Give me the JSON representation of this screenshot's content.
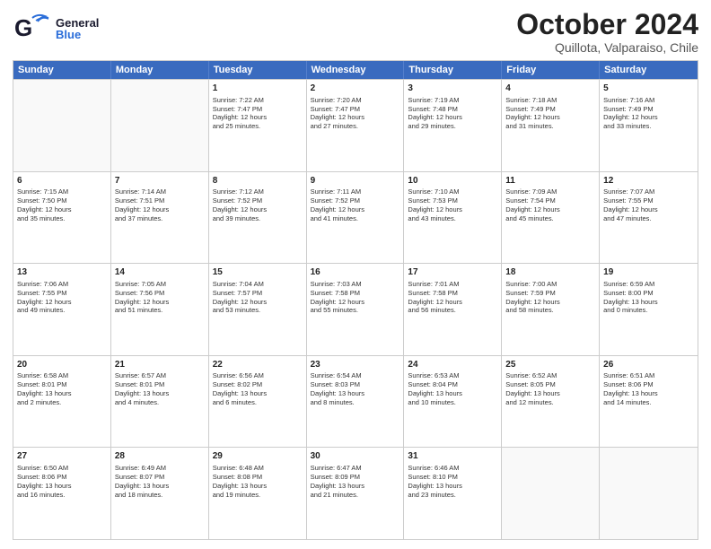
{
  "header": {
    "logo_general": "General",
    "logo_blue": "Blue",
    "month_title": "October 2024",
    "subtitle": "Quillota, Valparaiso, Chile"
  },
  "days_of_week": [
    "Sunday",
    "Monday",
    "Tuesday",
    "Wednesday",
    "Thursday",
    "Friday",
    "Saturday"
  ],
  "weeks": [
    [
      {
        "day": "",
        "empty": true
      },
      {
        "day": "",
        "empty": true
      },
      {
        "day": "1",
        "lines": [
          "Sunrise: 7:22 AM",
          "Sunset: 7:47 PM",
          "Daylight: 12 hours",
          "and 25 minutes."
        ]
      },
      {
        "day": "2",
        "lines": [
          "Sunrise: 7:20 AM",
          "Sunset: 7:47 PM",
          "Daylight: 12 hours",
          "and 27 minutes."
        ]
      },
      {
        "day": "3",
        "lines": [
          "Sunrise: 7:19 AM",
          "Sunset: 7:48 PM",
          "Daylight: 12 hours",
          "and 29 minutes."
        ]
      },
      {
        "day": "4",
        "lines": [
          "Sunrise: 7:18 AM",
          "Sunset: 7:49 PM",
          "Daylight: 12 hours",
          "and 31 minutes."
        ]
      },
      {
        "day": "5",
        "lines": [
          "Sunrise: 7:16 AM",
          "Sunset: 7:49 PM",
          "Daylight: 12 hours",
          "and 33 minutes."
        ]
      }
    ],
    [
      {
        "day": "6",
        "lines": [
          "Sunrise: 7:15 AM",
          "Sunset: 7:50 PM",
          "Daylight: 12 hours",
          "and 35 minutes."
        ]
      },
      {
        "day": "7",
        "lines": [
          "Sunrise: 7:14 AM",
          "Sunset: 7:51 PM",
          "Daylight: 12 hours",
          "and 37 minutes."
        ]
      },
      {
        "day": "8",
        "lines": [
          "Sunrise: 7:12 AM",
          "Sunset: 7:52 PM",
          "Daylight: 12 hours",
          "and 39 minutes."
        ]
      },
      {
        "day": "9",
        "lines": [
          "Sunrise: 7:11 AM",
          "Sunset: 7:52 PM",
          "Daylight: 12 hours",
          "and 41 minutes."
        ]
      },
      {
        "day": "10",
        "lines": [
          "Sunrise: 7:10 AM",
          "Sunset: 7:53 PM",
          "Daylight: 12 hours",
          "and 43 minutes."
        ]
      },
      {
        "day": "11",
        "lines": [
          "Sunrise: 7:09 AM",
          "Sunset: 7:54 PM",
          "Daylight: 12 hours",
          "and 45 minutes."
        ]
      },
      {
        "day": "12",
        "lines": [
          "Sunrise: 7:07 AM",
          "Sunset: 7:55 PM",
          "Daylight: 12 hours",
          "and 47 minutes."
        ]
      }
    ],
    [
      {
        "day": "13",
        "lines": [
          "Sunrise: 7:06 AM",
          "Sunset: 7:55 PM",
          "Daylight: 12 hours",
          "and 49 minutes."
        ]
      },
      {
        "day": "14",
        "lines": [
          "Sunrise: 7:05 AM",
          "Sunset: 7:56 PM",
          "Daylight: 12 hours",
          "and 51 minutes."
        ]
      },
      {
        "day": "15",
        "lines": [
          "Sunrise: 7:04 AM",
          "Sunset: 7:57 PM",
          "Daylight: 12 hours",
          "and 53 minutes."
        ]
      },
      {
        "day": "16",
        "lines": [
          "Sunrise: 7:03 AM",
          "Sunset: 7:58 PM",
          "Daylight: 12 hours",
          "and 55 minutes."
        ]
      },
      {
        "day": "17",
        "lines": [
          "Sunrise: 7:01 AM",
          "Sunset: 7:58 PM",
          "Daylight: 12 hours",
          "and 56 minutes."
        ]
      },
      {
        "day": "18",
        "lines": [
          "Sunrise: 7:00 AM",
          "Sunset: 7:59 PM",
          "Daylight: 12 hours",
          "and 58 minutes."
        ]
      },
      {
        "day": "19",
        "lines": [
          "Sunrise: 6:59 AM",
          "Sunset: 8:00 PM",
          "Daylight: 13 hours",
          "and 0 minutes."
        ]
      }
    ],
    [
      {
        "day": "20",
        "lines": [
          "Sunrise: 6:58 AM",
          "Sunset: 8:01 PM",
          "Daylight: 13 hours",
          "and 2 minutes."
        ]
      },
      {
        "day": "21",
        "lines": [
          "Sunrise: 6:57 AM",
          "Sunset: 8:01 PM",
          "Daylight: 13 hours",
          "and 4 minutes."
        ]
      },
      {
        "day": "22",
        "lines": [
          "Sunrise: 6:56 AM",
          "Sunset: 8:02 PM",
          "Daylight: 13 hours",
          "and 6 minutes."
        ]
      },
      {
        "day": "23",
        "lines": [
          "Sunrise: 6:54 AM",
          "Sunset: 8:03 PM",
          "Daylight: 13 hours",
          "and 8 minutes."
        ]
      },
      {
        "day": "24",
        "lines": [
          "Sunrise: 6:53 AM",
          "Sunset: 8:04 PM",
          "Daylight: 13 hours",
          "and 10 minutes."
        ]
      },
      {
        "day": "25",
        "lines": [
          "Sunrise: 6:52 AM",
          "Sunset: 8:05 PM",
          "Daylight: 13 hours",
          "and 12 minutes."
        ]
      },
      {
        "day": "26",
        "lines": [
          "Sunrise: 6:51 AM",
          "Sunset: 8:06 PM",
          "Daylight: 13 hours",
          "and 14 minutes."
        ]
      }
    ],
    [
      {
        "day": "27",
        "lines": [
          "Sunrise: 6:50 AM",
          "Sunset: 8:06 PM",
          "Daylight: 13 hours",
          "and 16 minutes."
        ]
      },
      {
        "day": "28",
        "lines": [
          "Sunrise: 6:49 AM",
          "Sunset: 8:07 PM",
          "Daylight: 13 hours",
          "and 18 minutes."
        ]
      },
      {
        "day": "29",
        "lines": [
          "Sunrise: 6:48 AM",
          "Sunset: 8:08 PM",
          "Daylight: 13 hours",
          "and 19 minutes."
        ]
      },
      {
        "day": "30",
        "lines": [
          "Sunrise: 6:47 AM",
          "Sunset: 8:09 PM",
          "Daylight: 13 hours",
          "and 21 minutes."
        ]
      },
      {
        "day": "31",
        "lines": [
          "Sunrise: 6:46 AM",
          "Sunset: 8:10 PM",
          "Daylight: 13 hours",
          "and 23 minutes."
        ]
      },
      {
        "day": "",
        "empty": true
      },
      {
        "day": "",
        "empty": true
      }
    ]
  ]
}
